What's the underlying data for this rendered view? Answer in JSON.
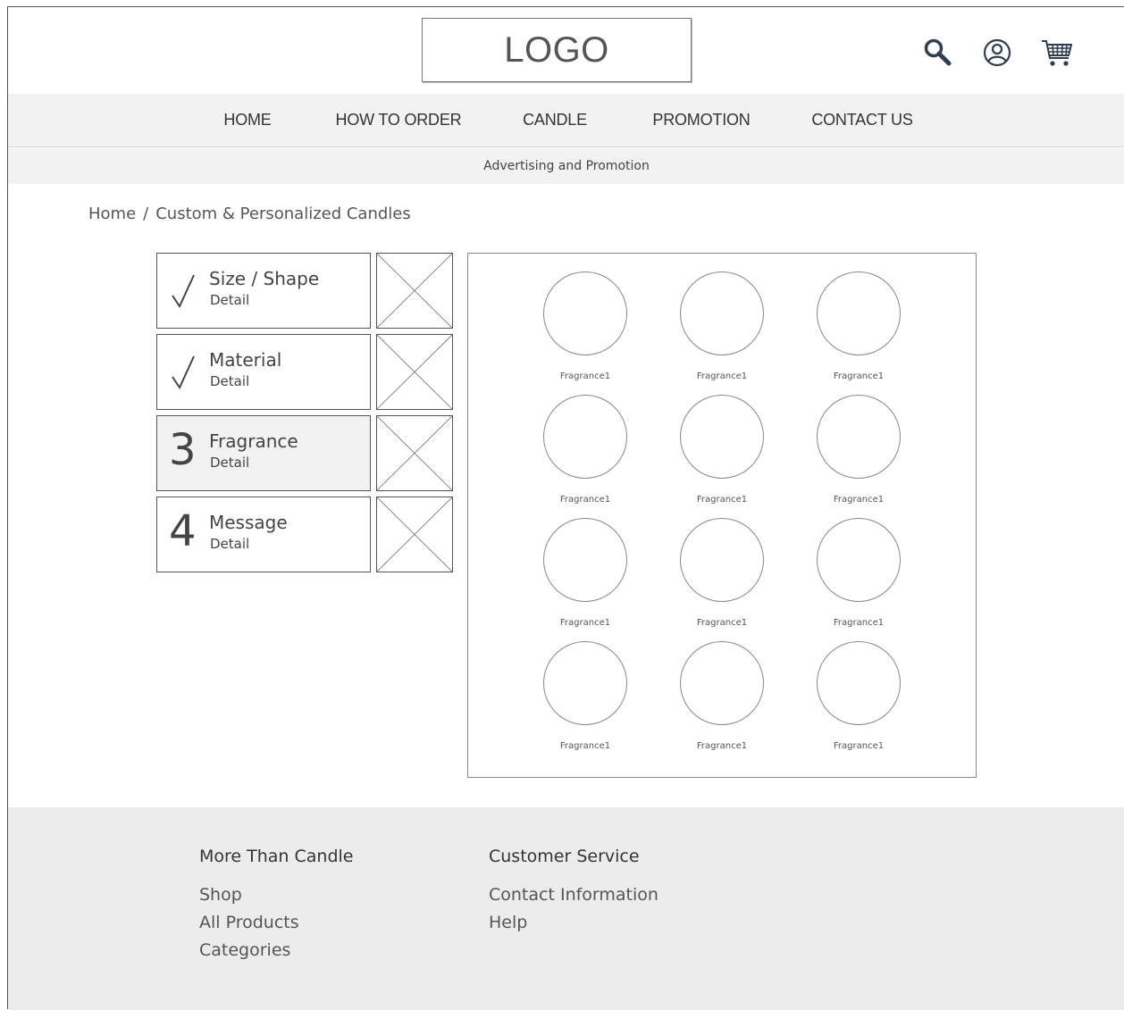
{
  "header": {
    "logo": "LOGO",
    "icons": [
      "search-icon",
      "user-icon",
      "cart-icon"
    ]
  },
  "nav": {
    "items": [
      {
        "label": "HOME"
      },
      {
        "label": "HOW TO ORDER"
      },
      {
        "label": "CANDLE"
      },
      {
        "label": "PROMOTION"
      },
      {
        "label": "CONTACT US"
      }
    ]
  },
  "promo_bar": "Advertising and Promotion",
  "breadcrumb": {
    "items": [
      {
        "label": "Home"
      },
      {
        "label": "Custom & Personalized Candles"
      }
    ],
    "separator": "/"
  },
  "steps": [
    {
      "marker": "√",
      "status": "completed",
      "title": "Size / Shape",
      "subtitle": "Detail"
    },
    {
      "marker": "√",
      "status": "completed",
      "title": "Material",
      "subtitle": "Detail"
    },
    {
      "marker": "3",
      "status": "current",
      "title": "Fragrance",
      "subtitle": "Detail"
    },
    {
      "marker": "4",
      "status": "pending",
      "title": "Message",
      "subtitle": "Detail"
    }
  ],
  "fragrances": [
    "Fragrance1",
    "Fragrance1",
    "Fragrance1",
    "Fragrance1",
    "Fragrance1",
    "Fragrance1",
    "Fragrance1",
    "Fragrance1",
    "Fragrance1",
    "Fragrance1",
    "Fragrance1",
    "Fragrance1"
  ],
  "footer": {
    "columns": [
      {
        "heading": "More Than Candle",
        "links": [
          "Shop",
          "All Products",
          "Categories"
        ]
      },
      {
        "heading": "Customer Service",
        "links": [
          "Contact Information",
          "Help"
        ]
      }
    ]
  }
}
